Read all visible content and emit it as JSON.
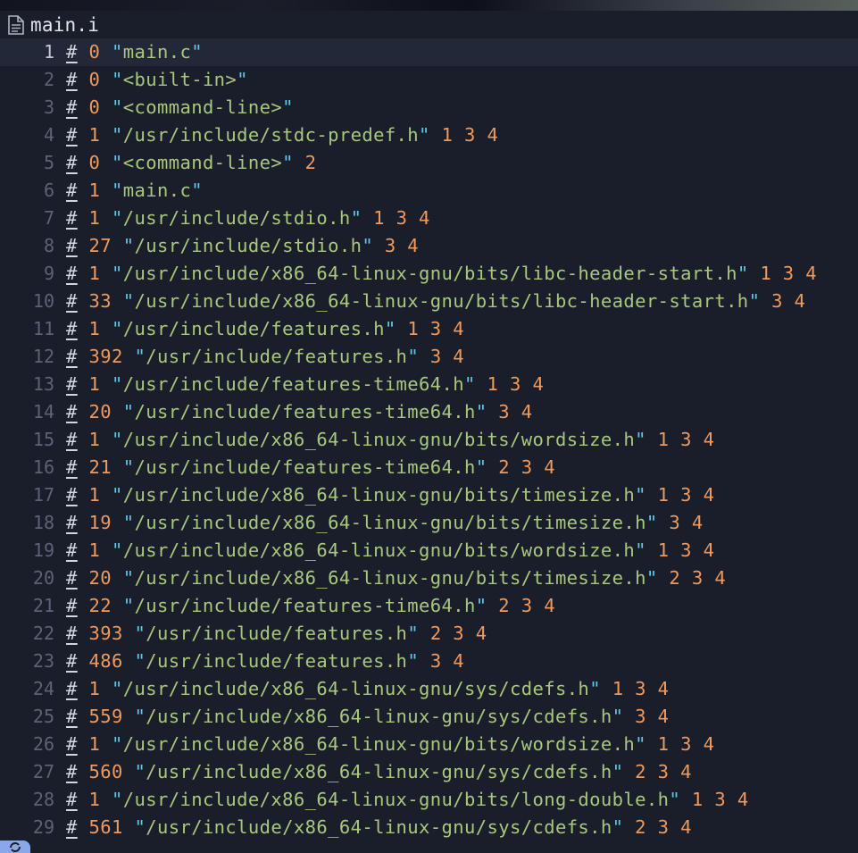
{
  "window": {
    "tab_title": "main.i",
    "tab_icon": "file-icon"
  },
  "colors": {
    "background": "#1a1e2a",
    "current_line": "#232839",
    "line_number": "#5b6377",
    "hash": "#d2d6e0",
    "number": "#f0995c",
    "quote": "#62c7e6",
    "string": "#a8c87e",
    "status_accent": "#8aa8e8"
  },
  "editor": {
    "current_line_index": 0,
    "lines": [
      {
        "n": "1",
        "hash": "#",
        "num": "0",
        "q1": "\"",
        "path": "main.c",
        "q2": "\"",
        "flags": ""
      },
      {
        "n": "2",
        "hash": "#",
        "num": "0",
        "q1": "\"",
        "path": "<built-in>",
        "q2": "\"",
        "flags": ""
      },
      {
        "n": "3",
        "hash": "#",
        "num": "0",
        "q1": "\"",
        "path": "<command-line>",
        "q2": "\"",
        "flags": ""
      },
      {
        "n": "4",
        "hash": "#",
        "num": "1",
        "q1": "\"",
        "path": "/usr/include/stdc-predef.h",
        "q2": "\"",
        "flags": "1 3 4"
      },
      {
        "n": "5",
        "hash": "#",
        "num": "0",
        "q1": "\"",
        "path": "<command-line>",
        "q2": "\"",
        "flags": "2"
      },
      {
        "n": "6",
        "hash": "#",
        "num": "1",
        "q1": "\"",
        "path": "main.c",
        "q2": "\"",
        "flags": ""
      },
      {
        "n": "7",
        "hash": "#",
        "num": "1",
        "q1": "\"",
        "path": "/usr/include/stdio.h",
        "q2": "\"",
        "flags": "1 3 4"
      },
      {
        "n": "8",
        "hash": "#",
        "num": "27",
        "q1": "\"",
        "path": "/usr/include/stdio.h",
        "q2": "\"",
        "flags": "3 4"
      },
      {
        "n": "9",
        "hash": "#",
        "num": "1",
        "q1": "\"",
        "path": "/usr/include/x86_64-linux-gnu/bits/libc-header-start.h",
        "q2": "\"",
        "flags": "1 3 4"
      },
      {
        "n": "10",
        "hash": "#",
        "num": "33",
        "q1": "\"",
        "path": "/usr/include/x86_64-linux-gnu/bits/libc-header-start.h",
        "q2": "\"",
        "flags": "3 4"
      },
      {
        "n": "11",
        "hash": "#",
        "num": "1",
        "q1": "\"",
        "path": "/usr/include/features.h",
        "q2": "\"",
        "flags": "1 3 4"
      },
      {
        "n": "12",
        "hash": "#",
        "num": "392",
        "q1": "\"",
        "path": "/usr/include/features.h",
        "q2": "\"",
        "flags": "3 4"
      },
      {
        "n": "13",
        "hash": "#",
        "num": "1",
        "q1": "\"",
        "path": "/usr/include/features-time64.h",
        "q2": "\"",
        "flags": "1 3 4"
      },
      {
        "n": "14",
        "hash": "#",
        "num": "20",
        "q1": "\"",
        "path": "/usr/include/features-time64.h",
        "q2": "\"",
        "flags": "3 4"
      },
      {
        "n": "15",
        "hash": "#",
        "num": "1",
        "q1": "\"",
        "path": "/usr/include/x86_64-linux-gnu/bits/wordsize.h",
        "q2": "\"",
        "flags": "1 3 4"
      },
      {
        "n": "16",
        "hash": "#",
        "num": "21",
        "q1": "\"",
        "path": "/usr/include/features-time64.h",
        "q2": "\"",
        "flags": "2 3 4"
      },
      {
        "n": "17",
        "hash": "#",
        "num": "1",
        "q1": "\"",
        "path": "/usr/include/x86_64-linux-gnu/bits/timesize.h",
        "q2": "\"",
        "flags": "1 3 4"
      },
      {
        "n": "18",
        "hash": "#",
        "num": "19",
        "q1": "\"",
        "path": "/usr/include/x86_64-linux-gnu/bits/timesize.h",
        "q2": "\"",
        "flags": "3 4"
      },
      {
        "n": "19",
        "hash": "#",
        "num": "1",
        "q1": "\"",
        "path": "/usr/include/x86_64-linux-gnu/bits/wordsize.h",
        "q2": "\"",
        "flags": "1 3 4"
      },
      {
        "n": "20",
        "hash": "#",
        "num": "20",
        "q1": "\"",
        "path": "/usr/include/x86_64-linux-gnu/bits/timesize.h",
        "q2": "\"",
        "flags": "2 3 4"
      },
      {
        "n": "21",
        "hash": "#",
        "num": "22",
        "q1": "\"",
        "path": "/usr/include/features-time64.h",
        "q2": "\"",
        "flags": "2 3 4"
      },
      {
        "n": "22",
        "hash": "#",
        "num": "393",
        "q1": "\"",
        "path": "/usr/include/features.h",
        "q2": "\"",
        "flags": "2 3 4"
      },
      {
        "n": "23",
        "hash": "#",
        "num": "486",
        "q1": "\"",
        "path": "/usr/include/features.h",
        "q2": "\"",
        "flags": "3 4"
      },
      {
        "n": "24",
        "hash": "#",
        "num": "1",
        "q1": "\"",
        "path": "/usr/include/x86_64-linux-gnu/sys/cdefs.h",
        "q2": "\"",
        "flags": "1 3 4"
      },
      {
        "n": "25",
        "hash": "#",
        "num": "559",
        "q1": "\"",
        "path": "/usr/include/x86_64-linux-gnu/sys/cdefs.h",
        "q2": "\"",
        "flags": "3 4"
      },
      {
        "n": "26",
        "hash": "#",
        "num": "1",
        "q1": "\"",
        "path": "/usr/include/x86_64-linux-gnu/bits/wordsize.h",
        "q2": "\"",
        "flags": "1 3 4"
      },
      {
        "n": "27",
        "hash": "#",
        "num": "560",
        "q1": "\"",
        "path": "/usr/include/x86_64-linux-gnu/sys/cdefs.h",
        "q2": "\"",
        "flags": "2 3 4"
      },
      {
        "n": "28",
        "hash": "#",
        "num": "1",
        "q1": "\"",
        "path": "/usr/include/x86_64-linux-gnu/bits/long-double.h",
        "q2": "\"",
        "flags": "1 3 4"
      },
      {
        "n": "29",
        "hash": "#",
        "num": "561",
        "q1": "\"",
        "path": "/usr/include/x86_64-linux-gnu/sys/cdefs.h",
        "q2": "\"",
        "flags": "2 3 4"
      }
    ]
  },
  "status": {
    "icon": "sync-icon"
  }
}
